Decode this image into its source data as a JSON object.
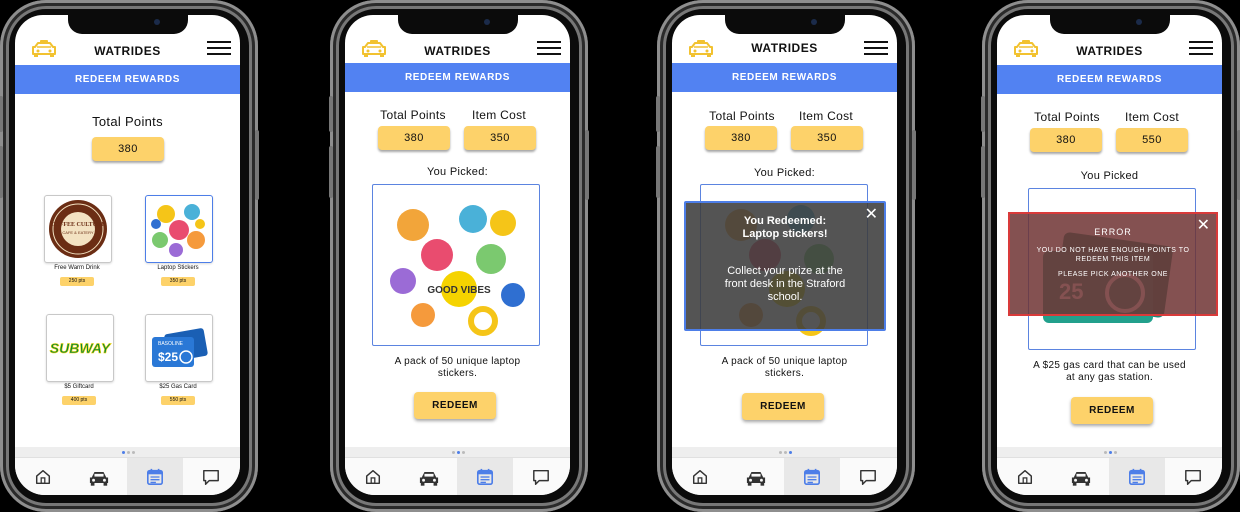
{
  "app": {
    "title": "WATRIDES",
    "banner": "REDEEM REWARDS"
  },
  "colors": {
    "accent": "#5282f2",
    "pill": "#fdd26a",
    "error_border": "#d93a3a"
  },
  "screen1": {
    "total_label": "Total Points",
    "total_value": "380",
    "items": [
      {
        "name": "Free Warm Drink",
        "points": "250 pts",
        "logo": "COFFEE CULTURE",
        "logo_sub": "CAFE & EATERY"
      },
      {
        "name": "Laptop Stickers",
        "points": "350 pts"
      },
      {
        "name": "$5 Giftcard",
        "points": "400 pts",
        "logo": "SUBWAY"
      },
      {
        "name": "$25 Gas Card",
        "points": "550 pts",
        "logo": "$25",
        "logo_top": "BASOLINE",
        "logo_sub": "GASOLINE"
      }
    ]
  },
  "screen2": {
    "total_label": "Total Points",
    "total_value": "380",
    "cost_label": "Item Cost",
    "cost_value": "350",
    "picked": "You Picked:",
    "description": "A pack of 50 unique laptop stickers.",
    "redeem": "REDEEM",
    "sticker_text": "GOOD VIBES"
  },
  "screen3": {
    "total_label": "Total Points",
    "total_value": "380",
    "cost_label": "Item Cost",
    "cost_value": "350",
    "picked": "You Picked:",
    "description": "A pack of 50 unique laptop stickers.",
    "redeem": "REDEEM",
    "modal": {
      "title": "You Redeemed: Laptop stickers!",
      "body": "Collect your prize at the front desk in the Straford school.",
      "close": "✕"
    }
  },
  "screen4": {
    "total_label": "Total Points",
    "total_value": "380",
    "cost_label": "Item Cost",
    "cost_value": "550",
    "picked": "You Picked",
    "description": "A $25 gas card that can be used at any gas station.",
    "redeem": "REDEEM",
    "modal": {
      "title": "ERROR",
      "line1": "YOU DO NOT HAVE ENOUGH POINTS TO REDEEM THIS ITEM",
      "line2": "PLEASE PICK ANOTHER ONE",
      "close": "✕"
    },
    "card_value": "25"
  },
  "tabs": [
    {
      "name": "home",
      "icon": "home-icon"
    },
    {
      "name": "rides",
      "icon": "car-icon"
    },
    {
      "name": "rewards",
      "icon": "calendar-icon"
    },
    {
      "name": "messages",
      "icon": "chat-icon"
    }
  ]
}
